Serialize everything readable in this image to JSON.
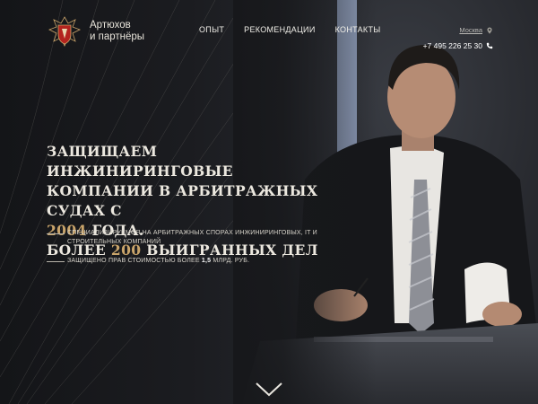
{
  "brand": {
    "line1": "Артюхов",
    "line2": "и партнёры",
    "logo_icon": "crest-logo-icon"
  },
  "nav": [
    {
      "label": "ОПЫТ"
    },
    {
      "label": "РЕКОМЕНДАЦИИ"
    },
    {
      "label": "КОНТАКТЫ"
    }
  ],
  "contact": {
    "city": "Москва",
    "phone": "+7 495 226 25 30"
  },
  "headline": {
    "line1": "ЗАЩИЩАЕМ ИНЖИНИРИНГОВЫЕ",
    "line2": "КОМПАНИИ В АРБИТРАЖНЫХ СУДАХ С",
    "year": "2004",
    "line3_rest": " ГОДА.",
    "line4_prefix": "БОЛЕЕ ",
    "count": "200",
    "line4_suffix": " ВЫИГРАННЫХ ДЕЛ"
  },
  "bullets": {
    "b1": "СПЕЦИАЛИЗИРУЕМСЯ НА АРБИТРАЖНЫХ СПОРАХ ИНЖИНИРИНГОВЫХ, IT И СТРОИТЕЛЬНЫХ КОМПАНИЙ",
    "b2_prefix": "ЗАЩИЩЕНО ПРАВ СТОИМОСТЬЮ БОЛЕЕ ",
    "b2_value": "1,5",
    "b2_suffix": " МЛРД. РУБ."
  },
  "colors": {
    "accent": "#c9a46a",
    "background": "#17181b",
    "text": "#ece8df"
  },
  "icons": {
    "location": "location-pin-icon",
    "phone": "phone-icon",
    "scroll": "chevron-down-icon"
  }
}
